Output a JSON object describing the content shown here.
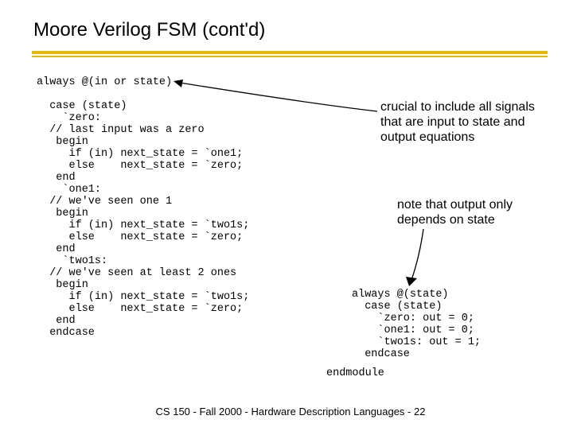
{
  "title": "Moore Verilog FSM (cont'd)",
  "code_left": "always @(in or state)\n\n  case (state)\n    `zero:\n  // last input was a zero\n   begin\n     if (in) next_state = `one1;\n     else    next_state = `zero;\n   end\n    `one1:\n  // we've seen one 1\n   begin\n     if (in) next_state = `two1s;\n     else    next_state = `zero;\n   end\n    `two1s:\n  // we've seen at least 2 ones\n   begin\n     if (in) next_state = `two1s;\n     else    next_state = `zero;\n   end\n  endcase",
  "note1": "crucial to include all signals that are input to state and output equations",
  "note2": "note that output only depends on state",
  "code_right": "always @(state)\n  case (state)\n    `zero: out = 0;\n    `one1: out = 0;\n    `two1s: out = 1;\n  endcase",
  "endmodule": "endmodule",
  "footer": "CS 150 - Fall 2000 - Hardware Description Languages - 22"
}
